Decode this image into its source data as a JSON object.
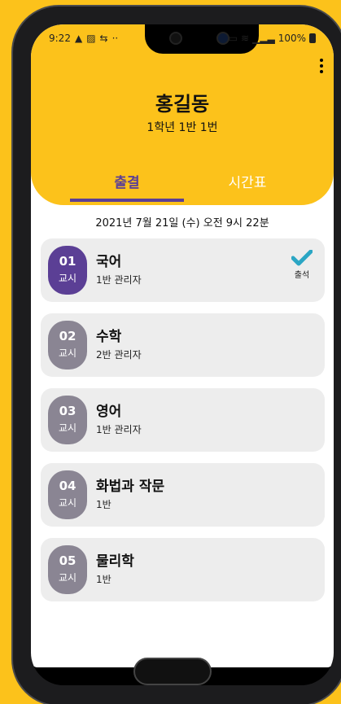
{
  "status_bar": {
    "time": "9:22",
    "battery": "100%"
  },
  "header": {
    "name": "홍길동",
    "subtitle": "1학년 1반 1번"
  },
  "tabs": [
    {
      "label": "출결",
      "active": true
    },
    {
      "label": "시간표",
      "active": false
    }
  ],
  "date": "2021년 7월 21일 (수) 오전 9시 22분",
  "period_label": "교시",
  "classes": [
    {
      "num": "01",
      "subject": "국어",
      "class_info": "1반  관리자",
      "attendance": "출석"
    },
    {
      "num": "02",
      "subject": "수학",
      "class_info": "2반  관리자"
    },
    {
      "num": "03",
      "subject": "영어",
      "class_info": "1반  관리자"
    },
    {
      "num": "04",
      "subject": "화법과 작문",
      "class_info": "1반"
    },
    {
      "num": "05",
      "subject": "물리학",
      "class_info": "1반"
    }
  ],
  "colors": {
    "accent": "#5B3F95",
    "header_bg": "#FCC21B",
    "check": "#2BA6C4",
    "inactive_period": "#8A8593"
  }
}
